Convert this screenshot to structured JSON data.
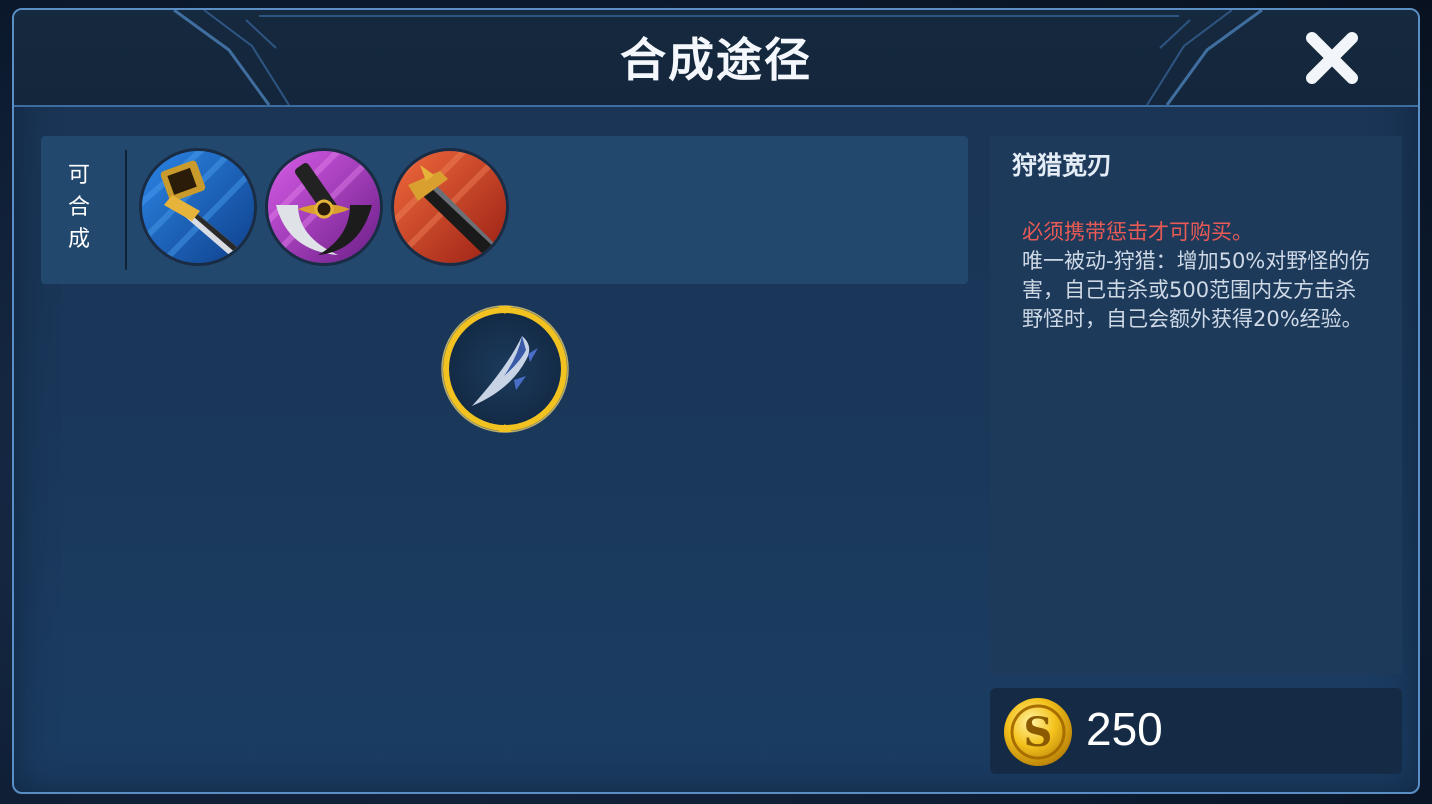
{
  "dialog": {
    "title": "合成途径",
    "close_icon": "close-x-icon"
  },
  "recipe": {
    "label_chars": [
      "可",
      "合",
      "成"
    ],
    "items": [
      {
        "icon": "sword-with-badge-icon",
        "bg_color": "#1e66c0"
      },
      {
        "icon": "crescent-axe-icon",
        "bg_color": "#9b38b8"
      },
      {
        "icon": "dark-blade-icon",
        "bg_color": "#c43a22"
      }
    ]
  },
  "selected_item": {
    "icon": "hunting-blade-icon",
    "ring_color": "#f2c320"
  },
  "info": {
    "name": "狩猎宽刃",
    "requirement": "必须携带惩击才可购买。",
    "description": "唯一被动-狩猎：增加50%对野怪的伤害，自己击杀或500范围内友方击杀野怪时，自己会额外获得20%经验。"
  },
  "price": {
    "icon": "gold-coin-icon",
    "value": "250"
  }
}
